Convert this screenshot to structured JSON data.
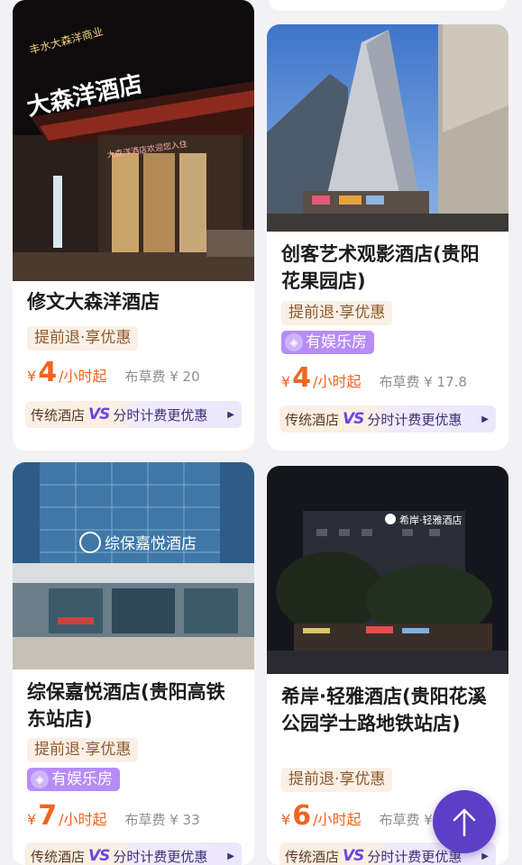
{
  "hotels": [
    {
      "name": "修文大森洋酒店",
      "promo": "提前退·享优惠",
      "entertainment": "",
      "currency": "¥",
      "price": "4",
      "unit": "/小时起",
      "fee": "布草费 ¥ 20",
      "vs_left": "传统酒店",
      "vs_mid": "VS",
      "vs_right": "分时计费更优惠",
      "sign_text": "大森洋酒店",
      "sign_sub": "大森洋酒店欢迎您入住",
      "top_sign": "丰水大森洋商业"
    },
    {
      "name": "创客艺术观影酒店(贵阳花果园店)",
      "promo": "提前退·享优惠",
      "entertainment": "有娱乐房",
      "currency": "¥",
      "price": "4",
      "unit": "/小时起",
      "fee": "布草费 ¥ 17.8",
      "vs_left": "传统酒店",
      "vs_mid": "VS",
      "vs_right": "分时计费更优惠"
    },
    {
      "name": "综保嘉悦酒店(贵阳高铁东站店)",
      "promo": "提前退·享优惠",
      "entertainment": "有娱乐房",
      "currency": "¥",
      "price": "7",
      "unit": "/小时起",
      "fee": "布草费 ¥ 33",
      "vs_left": "传统酒店",
      "vs_mid": "VS",
      "vs_right": "分时计费更优惠",
      "sign_text": "综保嘉悦酒店"
    },
    {
      "name": "希岸·轻雅酒店(贵阳花溪公园学士路地铁站店)",
      "promo": "提前退·享优惠",
      "entertainment": "",
      "currency": "¥",
      "price": "6",
      "unit": "/小时起",
      "fee": "布草费 ¥",
      "vs_left": "传统酒店",
      "vs_mid": "VS",
      "vs_right": "分时计费更优惠",
      "sign_text": "希岸·轻雅酒店"
    }
  ],
  "icons": {
    "entertainment": "ticket-icon",
    "vs_arrow": "triangle-right-icon",
    "fab": "arrow-up-icon"
  },
  "colors": {
    "accent_orange": "#f0641e",
    "purple_tag": "#b78cf7",
    "fab": "#5b3fc7"
  }
}
